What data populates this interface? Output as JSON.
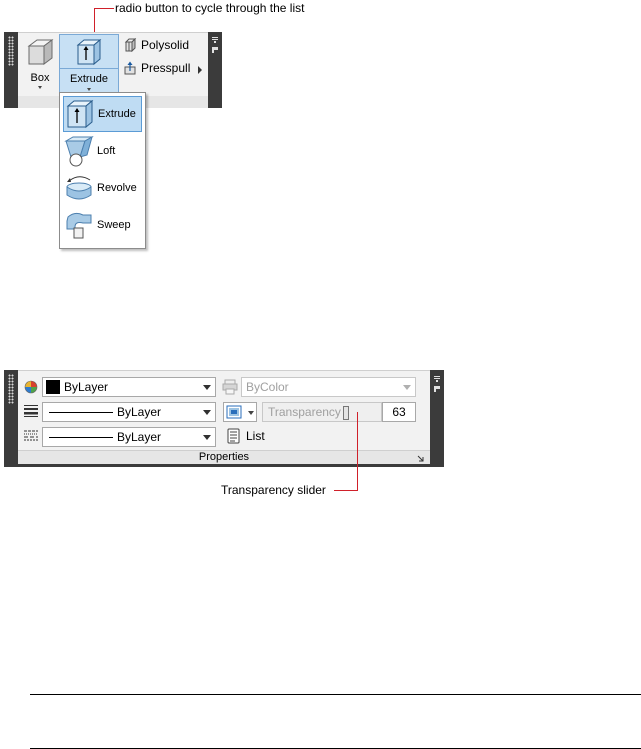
{
  "callouts": {
    "top": "radio button to cycle through the list",
    "bottom": "Transparency slider"
  },
  "modeling_panel": {
    "box_label": "Box",
    "extrude_label": "Extrude",
    "polysolid_label": "Polysolid",
    "presspull_label": "Presspull",
    "flyout_items": [
      {
        "label": "Extrude",
        "icon": "extrude-icon",
        "selected": true
      },
      {
        "label": "Loft",
        "icon": "loft-icon",
        "selected": false
      },
      {
        "label": "Revolve",
        "icon": "revolve-icon",
        "selected": false
      },
      {
        "label": "Sweep",
        "icon": "sweep-icon",
        "selected": false
      }
    ]
  },
  "properties_panel": {
    "title": "Properties",
    "color_value": "ByLayer",
    "plot_style_value": "ByColor",
    "linetype_value": "ByLayer",
    "transparency_label": "Transparency",
    "transparency_value": "63",
    "lineweight_value": "ByLayer",
    "list_label": "List"
  },
  "colors": {
    "callout_line": "#d0202a",
    "panel_frame": "#3b3b3b",
    "selection_fill": "#bfdcf3",
    "selection_border": "#5b9bd5"
  }
}
